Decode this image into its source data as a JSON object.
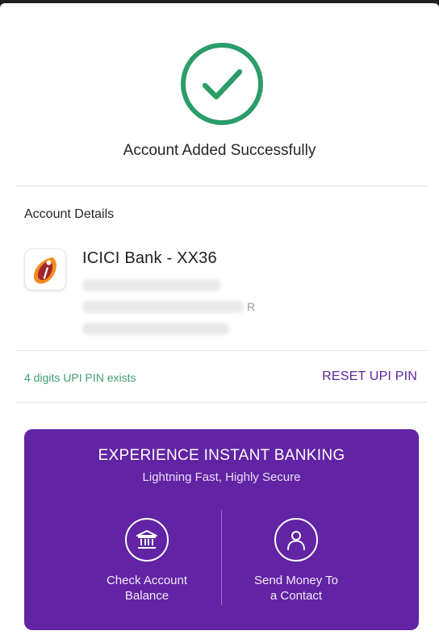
{
  "status": {
    "title": "Account Added Successfully",
    "icon": "check-circle-icon",
    "color": "#2a9d68"
  },
  "account_details": {
    "section_title": "Account Details",
    "bank_logo_icon": "icici-bank-logo",
    "bank_name": "ICICI Bank - XX36",
    "redacted_tail": "R"
  },
  "upi": {
    "pin_status": "4 digits UPI PIN exists",
    "reset_label": "RESET UPI PIN"
  },
  "promo": {
    "title": "EXPERIENCE INSTANT BANKING",
    "subtitle": "Lightning Fast, Highly Secure",
    "background": "#6223a4",
    "actions": [
      {
        "icon": "bank-icon",
        "label": "Check Account\nBalance"
      },
      {
        "icon": "user-icon",
        "label": "Send Money To\na Contact"
      }
    ]
  }
}
